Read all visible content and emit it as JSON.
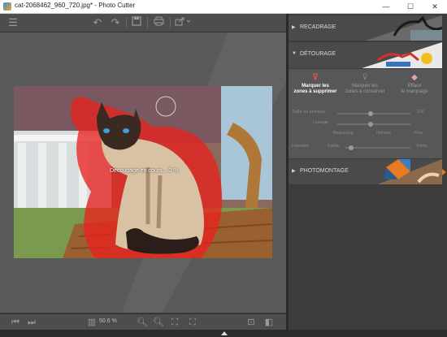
{
  "window": {
    "title": "cat-2068462_960_720.jpg* - Photo Cutter",
    "minimize": "—",
    "maximize": "☐",
    "close": "✕"
  },
  "toolbar": {
    "icons": [
      "menu-icon",
      "undo-icon",
      "redo-icon",
      "save-icon",
      "print-icon",
      "share-icon"
    ]
  },
  "canvas": {
    "progress_text": "Découpage en cours... 0 %"
  },
  "bottombar": {
    "zoom_label": "50.6 %"
  },
  "sidebar": {
    "recadrage": {
      "label": "RECADRAGE"
    },
    "detourage": {
      "label": "DÉTOURAGE",
      "modes": [
        {
          "label_line1": "Marquer les",
          "label_line2": "zones à supprimer",
          "active": true,
          "color": "#e85050"
        },
        {
          "label_line1": "Marquer les",
          "label_line2": "zones à conserver",
          "active": false,
          "color": "#5aa05a"
        },
        {
          "label_line1": "Efface",
          "label_line2": "le marquage",
          "active": false,
          "color": "#e0a0c0"
        }
      ],
      "sliders": [
        {
          "label": "Taille du pinceau",
          "value": "100",
          "position": 0.45
        },
        {
          "label": "Lissage",
          "value": "",
          "position": 0.45
        },
        {
          "label": "Intensité",
          "value": "",
          "position": 0.3
        }
      ],
      "sub_labels": [
        "Beaucoup",
        "Normal",
        "Peu"
      ],
      "intensity_min": "Faible",
      "intensity_max": "Forte"
    },
    "photomontage": {
      "label": "PHOTOMONTAGE"
    }
  },
  "colors": {
    "selection_red": "#e8231f",
    "accent_orange": "#e87a20"
  }
}
